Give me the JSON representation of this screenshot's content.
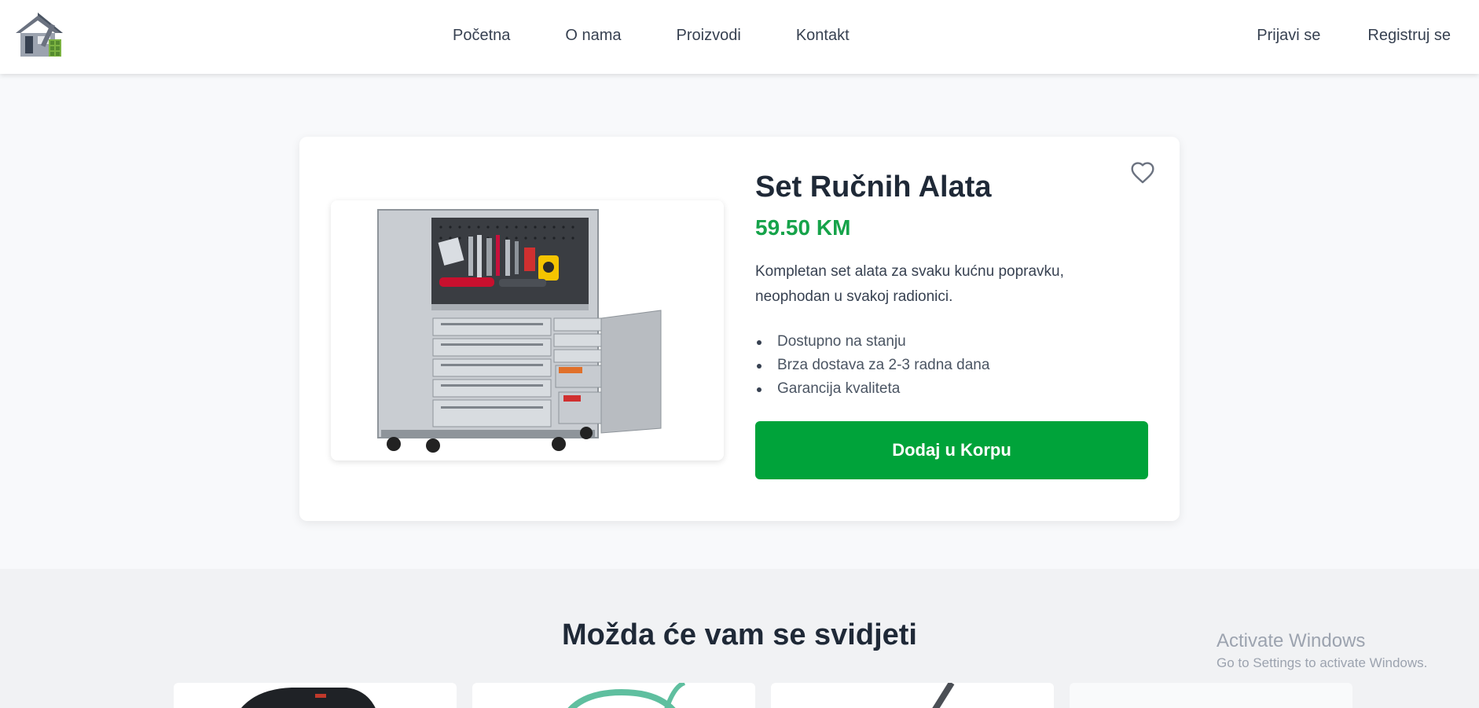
{
  "nav": {
    "logo_icon": "house-tools-logo",
    "links": [
      {
        "label": "Početna"
      },
      {
        "label": "O nama"
      },
      {
        "label": "Proizvodi"
      },
      {
        "label": "Kontakt"
      }
    ],
    "login_label": "Prijavi se",
    "register_label": "Registruj se"
  },
  "product": {
    "title": "Set Ručnih Alata",
    "price": "59.50 KM",
    "description": "Kompletan set alata za svaku kućnu popravku, neophodan u svakoj radionici.",
    "features": [
      "Dostupno na stanju",
      "Brza dostava za 2-3 radna dana",
      "Garancija kvaliteta"
    ],
    "add_to_cart_label": "Dodaj u Korpu",
    "image_icon": "tool-cabinet-image",
    "favorite_icon": "heart-icon"
  },
  "suggestions": {
    "title": "Možda će vam se svidjeti"
  },
  "watermark": {
    "title": "Activate Windows",
    "subtitle": "Go to Settings to activate Windows."
  },
  "colors": {
    "accent": "#00a33a",
    "price": "#16a34a",
    "text": "#1f2937",
    "background": "#f8f9fb"
  }
}
